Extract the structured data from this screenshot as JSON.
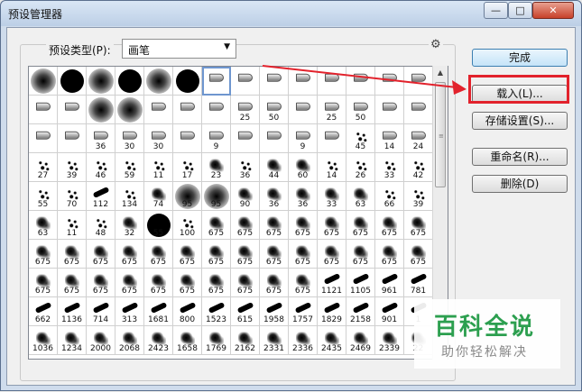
{
  "window": {
    "title": "预设管理器",
    "min_glyph": "—",
    "max_glyph": "□",
    "close_glyph": "✕"
  },
  "preset": {
    "type_label": "预设类型(P):",
    "type_value": "画笔",
    "dropdown_glyph": "▼",
    "gear_glyph": "⚙"
  },
  "buttons": {
    "done": "完成",
    "load": "载入(L)...",
    "save": "存储设置(S)...",
    "rename": "重命名(R)...",
    "delete": "删除(D)"
  },
  "brushes": [
    {
      "k": "soft",
      "n": ""
    },
    {
      "k": "hard",
      "n": ""
    },
    {
      "k": "soft",
      "n": ""
    },
    {
      "k": "hard",
      "n": ""
    },
    {
      "k": "soft",
      "n": ""
    },
    {
      "k": "hard",
      "n": ""
    },
    {
      "k": "tool",
      "n": "",
      "sel": true
    },
    {
      "k": "tool",
      "n": ""
    },
    {
      "k": "tool",
      "n": ""
    },
    {
      "k": "tool",
      "n": ""
    },
    {
      "k": "tool",
      "n": ""
    },
    {
      "k": "tool",
      "n": ""
    },
    {
      "k": "tool",
      "n": ""
    },
    {
      "k": "tool",
      "n": ""
    },
    {
      "k": "tool",
      "n": ""
    },
    {
      "k": "tool",
      "n": ""
    },
    {
      "k": "soft",
      "n": ""
    },
    {
      "k": "soft",
      "n": ""
    },
    {
      "k": "tool",
      "n": ""
    },
    {
      "k": "tool",
      "n": ""
    },
    {
      "k": "tool",
      "n": ""
    },
    {
      "k": "tool",
      "n": "25"
    },
    {
      "k": "tool",
      "n": "50"
    },
    {
      "k": "tool",
      "n": ""
    },
    {
      "k": "tool",
      "n": "25"
    },
    {
      "k": "tool",
      "n": "50"
    },
    {
      "k": "tool",
      "n": ""
    },
    {
      "k": "tool",
      "n": ""
    },
    {
      "k": "tool",
      "n": ""
    },
    {
      "k": "tool",
      "n": ""
    },
    {
      "k": "tool",
      "n": "36"
    },
    {
      "k": "tool",
      "n": "30"
    },
    {
      "k": "tool",
      "n": "30"
    },
    {
      "k": "tool",
      "n": ""
    },
    {
      "k": "tool",
      "n": "9"
    },
    {
      "k": "tool",
      "n": ""
    },
    {
      "k": "tool",
      "n": ""
    },
    {
      "k": "tool",
      "n": "9"
    },
    {
      "k": "tool",
      "n": ""
    },
    {
      "k": "dots",
      "n": "45"
    },
    {
      "k": "tool",
      "n": "14"
    },
    {
      "k": "tool",
      "n": "24"
    },
    {
      "k": "dots",
      "n": "27"
    },
    {
      "k": "dots",
      "n": "39"
    },
    {
      "k": "dots",
      "n": "46"
    },
    {
      "k": "dots",
      "n": "59"
    },
    {
      "k": "dots",
      "n": "11"
    },
    {
      "k": "dots",
      "n": "17"
    },
    {
      "k": "splat",
      "n": "23"
    },
    {
      "k": "dots",
      "n": "36"
    },
    {
      "k": "splat",
      "n": "44"
    },
    {
      "k": "splat",
      "n": "60"
    },
    {
      "k": "dots",
      "n": "14"
    },
    {
      "k": "dots",
      "n": "26"
    },
    {
      "k": "dots",
      "n": "33"
    },
    {
      "k": "dots",
      "n": "42"
    },
    {
      "k": "dots",
      "n": "55"
    },
    {
      "k": "dots",
      "n": "70"
    },
    {
      "k": "stroke",
      "n": "112"
    },
    {
      "k": "dots",
      "n": "134"
    },
    {
      "k": "splat",
      "n": "74"
    },
    {
      "k": "soft",
      "n": "95"
    },
    {
      "k": "soft",
      "n": "95"
    },
    {
      "k": "splat",
      "n": "90"
    },
    {
      "k": "splat",
      "n": "36"
    },
    {
      "k": "splat",
      "n": "36"
    },
    {
      "k": "splat",
      "n": "33"
    },
    {
      "k": "splat",
      "n": "63"
    },
    {
      "k": "dots",
      "n": "66"
    },
    {
      "k": "dots",
      "n": "39"
    },
    {
      "k": "splat",
      "n": "63"
    },
    {
      "k": "dots",
      "n": "11"
    },
    {
      "k": "dots",
      "n": "48"
    },
    {
      "k": "splat",
      "n": "32"
    },
    {
      "k": "hard",
      "n": "55"
    },
    {
      "k": "dots",
      "n": "100"
    },
    {
      "k": "splat",
      "n": "675"
    },
    {
      "k": "splat",
      "n": "675"
    },
    {
      "k": "splat",
      "n": "675"
    },
    {
      "k": "splat",
      "n": "675"
    },
    {
      "k": "splat",
      "n": "675"
    },
    {
      "k": "splat",
      "n": "675"
    },
    {
      "k": "splat",
      "n": "675"
    },
    {
      "k": "splat",
      "n": "675"
    },
    {
      "k": "splat",
      "n": "675"
    },
    {
      "k": "splat",
      "n": "675"
    },
    {
      "k": "splat",
      "n": "675"
    },
    {
      "k": "splat",
      "n": "675"
    },
    {
      "k": "splat",
      "n": "675"
    },
    {
      "k": "splat",
      "n": "675"
    },
    {
      "k": "splat",
      "n": "675"
    },
    {
      "k": "splat",
      "n": "675"
    },
    {
      "k": "splat",
      "n": "675"
    },
    {
      "k": "splat",
      "n": "675"
    },
    {
      "k": "splat",
      "n": "675"
    },
    {
      "k": "splat",
      "n": "675"
    },
    {
      "k": "splat",
      "n": "675"
    },
    {
      "k": "splat",
      "n": "675"
    },
    {
      "k": "splat",
      "n": "675"
    },
    {
      "k": "splat",
      "n": "675"
    },
    {
      "k": "splat",
      "n": "675"
    },
    {
      "k": "splat",
      "n": "675"
    },
    {
      "k": "splat",
      "n": "675"
    },
    {
      "k": "splat",
      "n": "675"
    },
    {
      "k": "splat",
      "n": "675"
    },
    {
      "k": "splat",
      "n": "675"
    },
    {
      "k": "splat",
      "n": "675"
    },
    {
      "k": "splat",
      "n": "675"
    },
    {
      "k": "stroke",
      "n": "1121"
    },
    {
      "k": "stroke",
      "n": "1105"
    },
    {
      "k": "stroke",
      "n": "961"
    },
    {
      "k": "stroke",
      "n": "781"
    },
    {
      "k": "stroke",
      "n": "662"
    },
    {
      "k": "stroke",
      "n": "1136"
    },
    {
      "k": "stroke",
      "n": "714"
    },
    {
      "k": "stroke",
      "n": "313"
    },
    {
      "k": "stroke",
      "n": "1681"
    },
    {
      "k": "stroke",
      "n": "800"
    },
    {
      "k": "stroke",
      "n": "1523"
    },
    {
      "k": "stroke",
      "n": "615"
    },
    {
      "k": "stroke",
      "n": "1958"
    },
    {
      "k": "stroke",
      "n": "1757"
    },
    {
      "k": "stroke",
      "n": "1829"
    },
    {
      "k": "stroke",
      "n": "2158"
    },
    {
      "k": "stroke",
      "n": "901"
    },
    {
      "k": "stroke",
      "n": "1"
    },
    {
      "k": "splat",
      "n": "1036"
    },
    {
      "k": "splat",
      "n": "1234"
    },
    {
      "k": "splat",
      "n": "2000"
    },
    {
      "k": "splat",
      "n": "2068"
    },
    {
      "k": "splat",
      "n": "2423"
    },
    {
      "k": "splat",
      "n": "1658"
    },
    {
      "k": "splat",
      "n": "1769"
    },
    {
      "k": "splat",
      "n": "2162"
    },
    {
      "k": "splat",
      "n": "2331"
    },
    {
      "k": "splat",
      "n": "2336"
    },
    {
      "k": "splat",
      "n": "2435"
    },
    {
      "k": "splat",
      "n": "2469"
    },
    {
      "k": "splat",
      "n": "2339"
    },
    {
      "k": "splat",
      "n": "22"
    }
  ],
  "watermark": {
    "logo": "百科全说",
    "sub": "助你轻松解决"
  },
  "colors": {
    "highlight_box": "#e2222c",
    "arrow": "#e2222c",
    "selection": "#6e96cf"
  }
}
